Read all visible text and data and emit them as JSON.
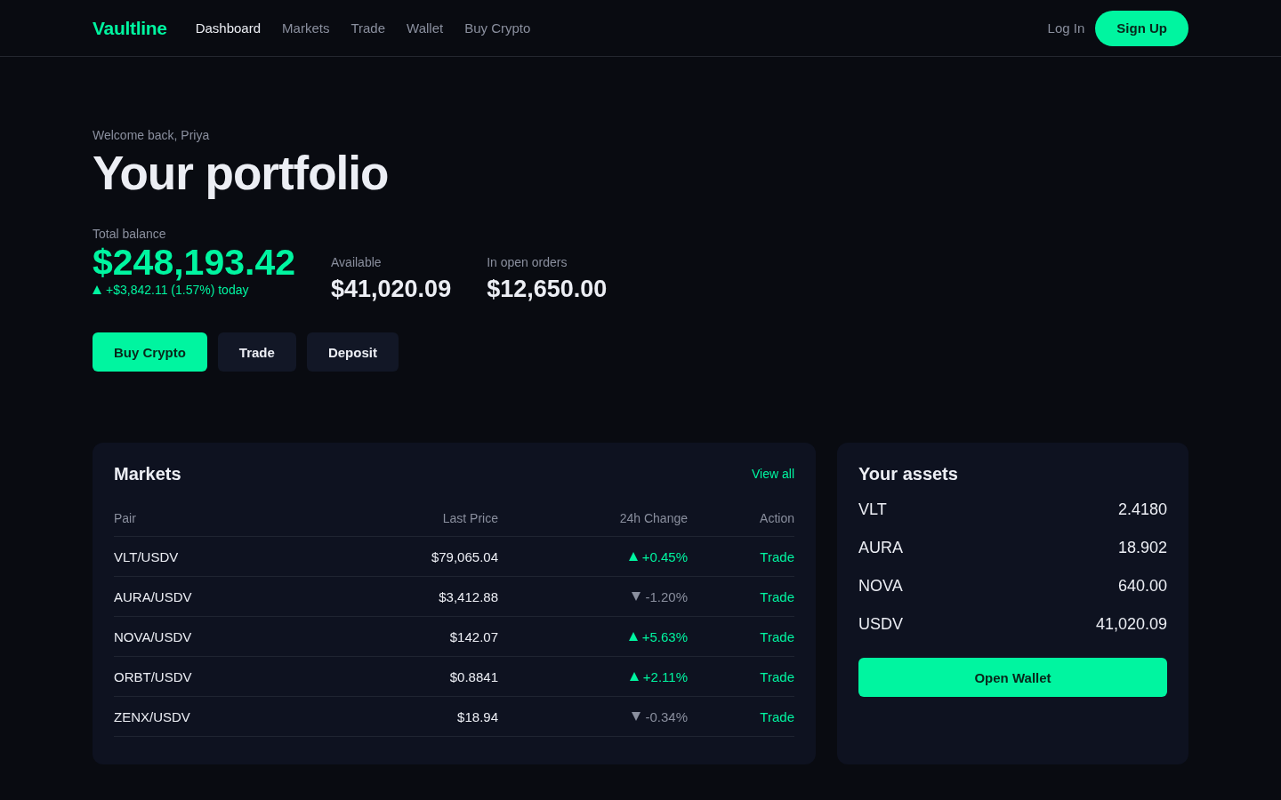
{
  "header": {
    "logo": "Vaultline",
    "nav": [
      {
        "label": "Dashboard",
        "selected": true
      },
      {
        "label": "Markets",
        "selected": false
      },
      {
        "label": "Trade",
        "selected": false
      },
      {
        "label": "Wallet",
        "selected": false
      },
      {
        "label": "Buy Crypto",
        "selected": false
      }
    ],
    "login": "Log In",
    "signup": "Sign Up"
  },
  "hero": {
    "greeting": "Welcome back, Priya",
    "title": "Your portfolio",
    "balance": {
      "label": "Total balance",
      "value": "$248,193.42",
      "change": {
        "kind": "gain",
        "text": "+$3,842.11 (1.57%) today"
      }
    },
    "stats": [
      {
        "label": "Available",
        "value": "$41,020.09"
      },
      {
        "label": "In open orders",
        "value": "$12,650.00"
      }
    ],
    "actions": [
      {
        "label": "Buy Crypto",
        "kind": "primary"
      },
      {
        "label": "Trade",
        "kind": "secondary"
      },
      {
        "label": "Deposit",
        "kind": "secondary"
      }
    ]
  },
  "markets": {
    "title": "Markets",
    "view_all": "View all",
    "columns": [
      "Pair",
      "Last Price",
      "24h Change",
      "Action"
    ],
    "rows": [
      {
        "pair": "VLT/USDV",
        "price": "$79,065.04",
        "change": "+0.45%",
        "kind": "gain",
        "action": "Trade"
      },
      {
        "pair": "AURA/USDV",
        "price": "$3,412.88",
        "change": "-1.20%",
        "kind": "loss",
        "action": "Trade"
      },
      {
        "pair": "NOVA/USDV",
        "price": "$142.07",
        "change": "+5.63%",
        "kind": "gain",
        "action": "Trade"
      },
      {
        "pair": "ORBT/USDV",
        "price": "$0.8841",
        "change": "+2.11%",
        "kind": "gain",
        "action": "Trade"
      },
      {
        "pair": "ZENX/USDV",
        "price": "$18.94",
        "change": "-0.34%",
        "kind": "loss",
        "action": "Trade"
      }
    ]
  },
  "assets": {
    "title": "Your assets",
    "rows": [
      {
        "symbol": "VLT",
        "amount": "2.4180"
      },
      {
        "symbol": "AURA",
        "amount": "18.902"
      },
      {
        "symbol": "NOVA",
        "amount": "640.00"
      },
      {
        "symbol": "USDV",
        "amount": "41,020.09"
      }
    ],
    "button": "Open Wallet"
  }
}
